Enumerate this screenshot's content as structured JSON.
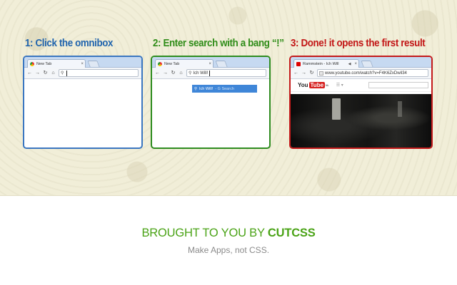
{
  "steps": [
    {
      "title": "1: Click the omnibox",
      "tab_label": "New Tab",
      "omnibox_value": ""
    },
    {
      "title": "2: Enter search with a bang “!”",
      "tab_label": "New Tab",
      "omnibox_value": "Ich Will!",
      "suggestion_main": "Ich Will!",
      "suggestion_sub": "- G Search"
    },
    {
      "title": "3: Done! it opens the first result",
      "tab_label": "Rammstein - Ich Will",
      "omnibox_value": "www.youtube.com/watch?v=F4K6ZxDwil34",
      "yt_you": "You",
      "yt_tube": "Tube",
      "yt_sup": "NL"
    }
  ],
  "footer": {
    "prefix": "BROUGHT TO YOU BY ",
    "brand": "CUTCSS",
    "tagline": "Make Apps, not CSS."
  },
  "colors": {
    "step1": "#1f63ad",
    "step2": "#2f8c18",
    "step3": "#c21616",
    "footer_green": "#4aa316"
  },
  "icons": [
    "chrome-favicon",
    "youtube-favicon",
    "back-arrow-icon",
    "forward-arrow-icon",
    "reload-icon",
    "home-icon",
    "search-icon",
    "close-icon",
    "audio-icon",
    "menu-icon"
  ]
}
